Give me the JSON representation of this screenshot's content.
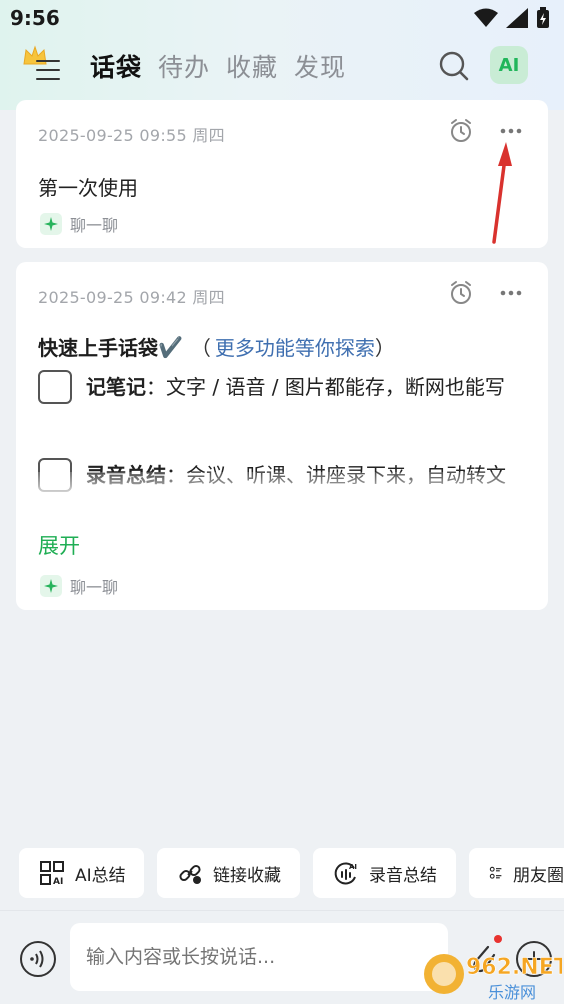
{
  "status_bar": {
    "time": "9:56"
  },
  "header": {
    "tabs": [
      {
        "label": "话袋",
        "active": true
      },
      {
        "label": "待办",
        "active": false
      },
      {
        "label": "收藏",
        "active": false
      },
      {
        "label": "发现",
        "active": false
      }
    ],
    "ai_label": "AI"
  },
  "notes": [
    {
      "date": "2025-09-25 09:55 周四",
      "text": "第一次使用",
      "chat_label": "聊一聊"
    },
    {
      "date": "2025-09-25 09:42 周四",
      "title_bold": "快速上手话袋",
      "title_mark": "✔️",
      "paren_open": "（",
      "title_link": "更多功能等你探索",
      "paren_close": "）",
      "items": [
        {
          "label": "记笔记",
          "text": "：文字 / 语音 / 图片都能存，断网也能写"
        },
        {
          "label": "录音总结",
          "text": "：会议、听课、讲座录下来，自动转文字，提炼重点"
        }
      ],
      "expand_label": "展开",
      "chat_label": "聊一聊"
    }
  ],
  "quick_actions": [
    {
      "label": "AI总结",
      "icon": "ai-summary-icon"
    },
    {
      "label": "链接收藏",
      "icon": "link-icon"
    },
    {
      "label": "录音总结",
      "icon": "record-ai-icon"
    },
    {
      "label": "朋友圈",
      "icon": "list-icon"
    }
  ],
  "input": {
    "placeholder": "输入内容或长按说话..."
  },
  "watermark": {
    "brand": "962.NET",
    "sub": "乐游网"
  },
  "colors": {
    "accent": "#1fae54",
    "link": "#3f6fb0",
    "annotation_arrow": "#d9322e"
  }
}
